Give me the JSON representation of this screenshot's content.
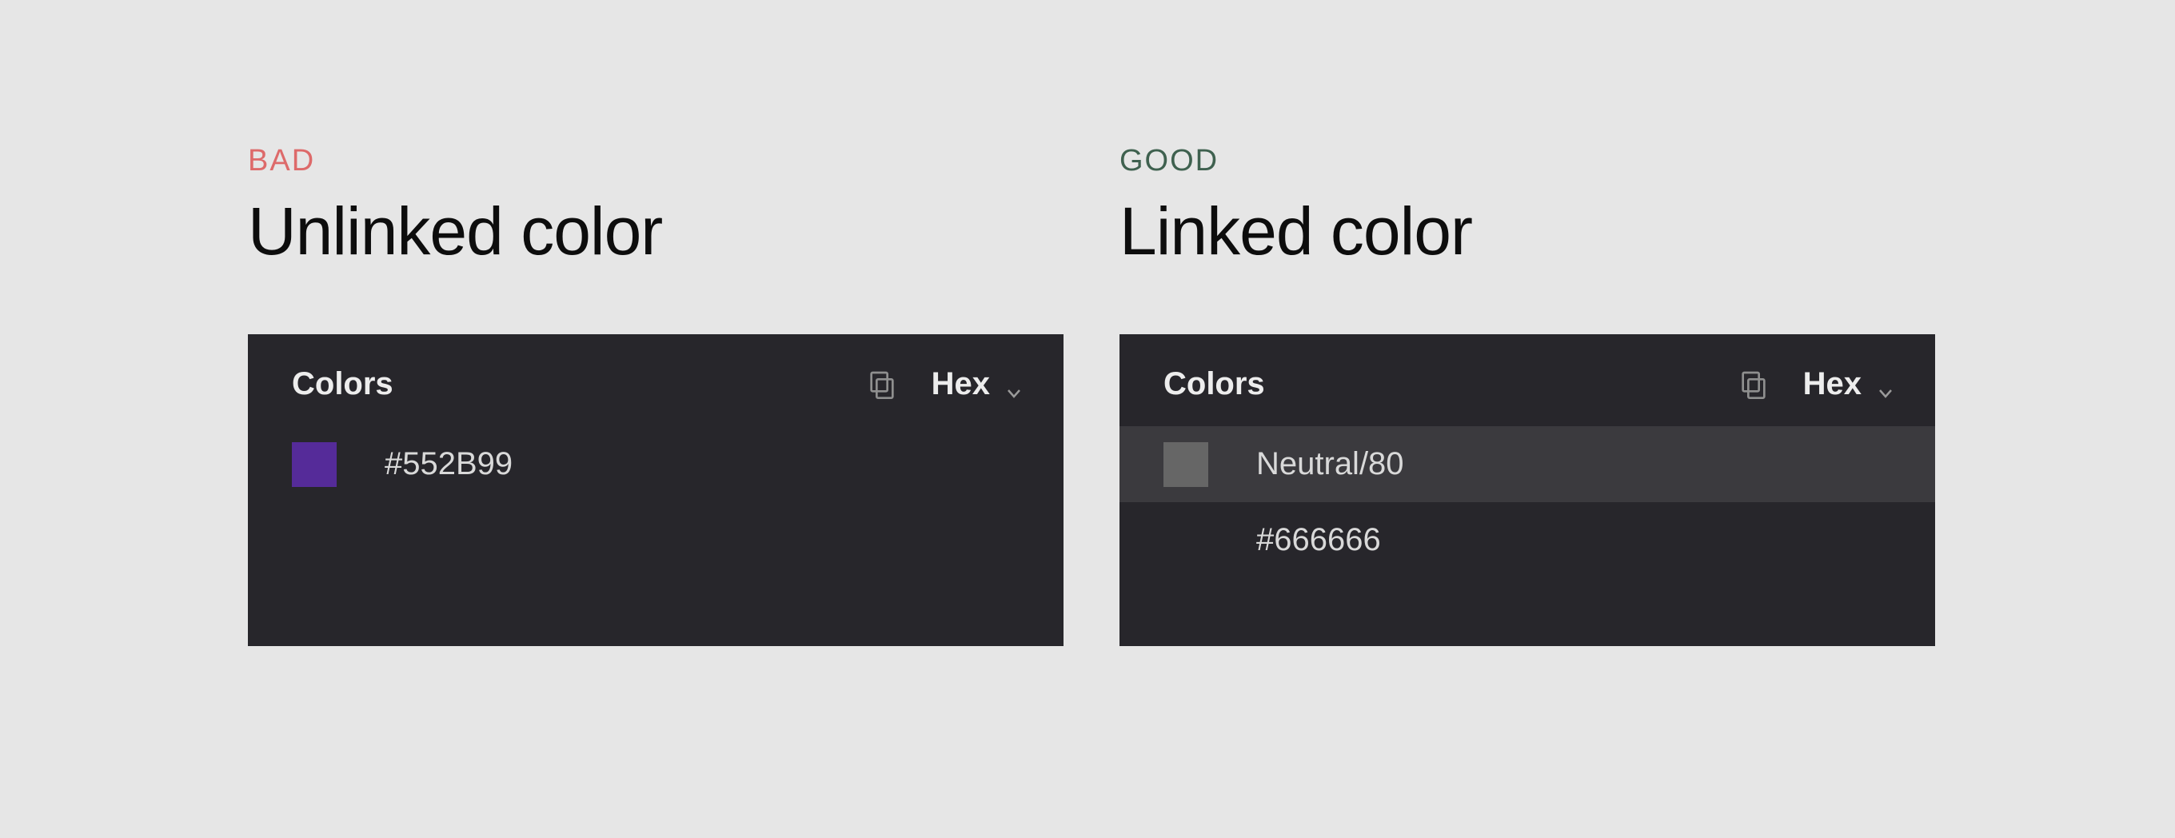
{
  "bad": {
    "tag": "BAD",
    "title": "Unlinked color",
    "panel_title": "Colors",
    "format": "Hex",
    "swatch_color": "#552B99",
    "value": "#552B99"
  },
  "good": {
    "tag": "GOOD",
    "title": "Linked color",
    "panel_title": "Colors",
    "format": "Hex",
    "token_swatch_color": "#666666",
    "token_name": "Neutral/80",
    "hex_value": "#666666"
  },
  "colors": {
    "bad_tag": "#dd6a6a",
    "good_tag": "#3f614f",
    "panel_bg": "#27262b",
    "row_highlight": "#3b3a3e"
  }
}
